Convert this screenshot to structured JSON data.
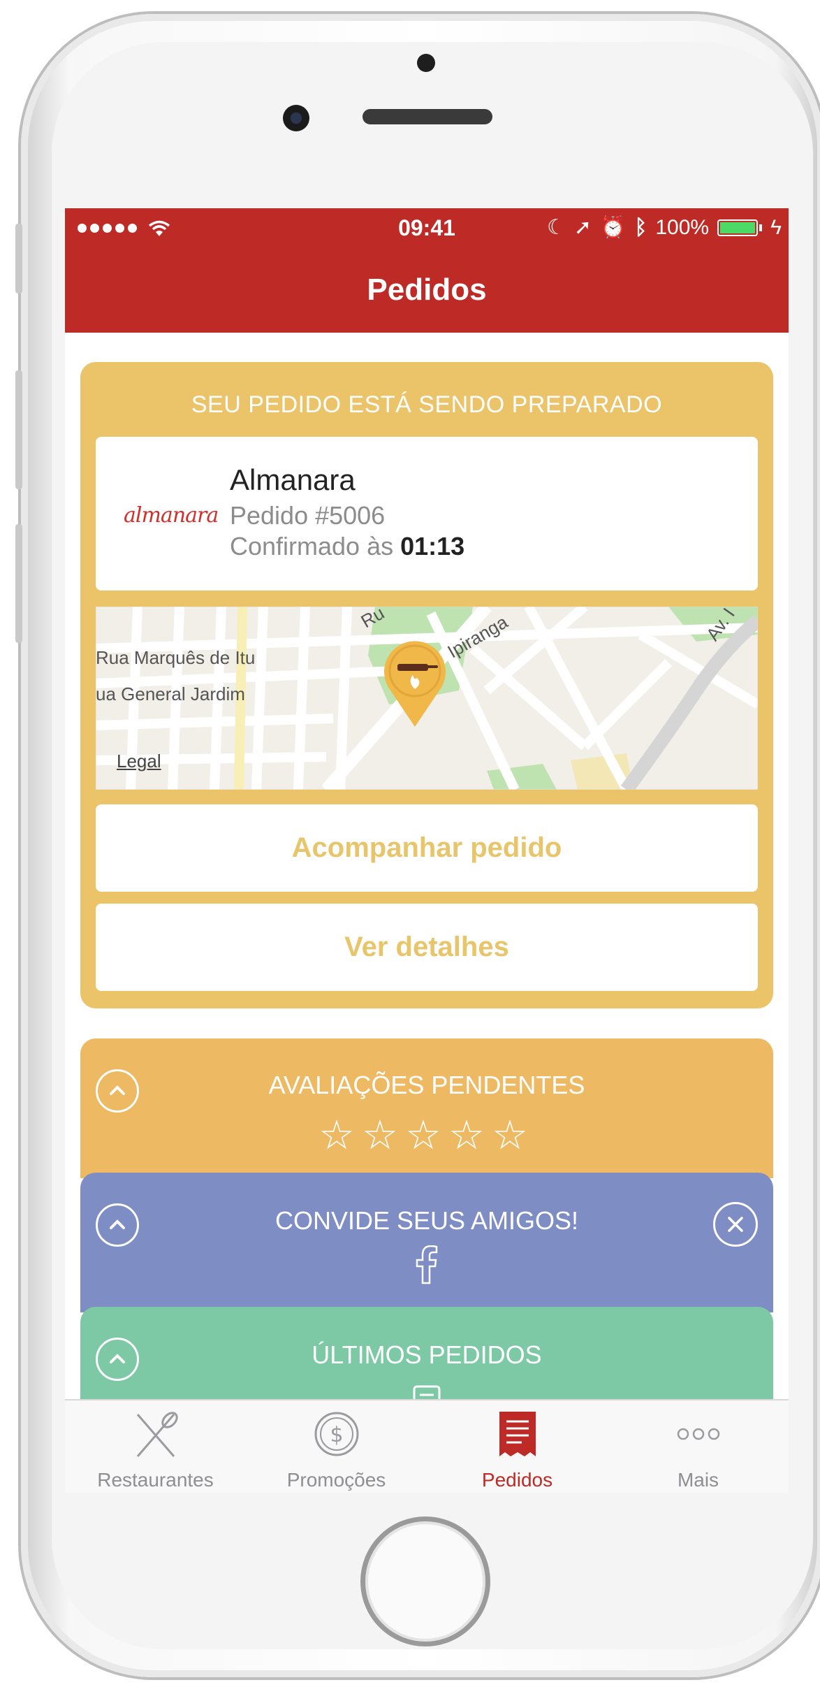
{
  "status_bar": {
    "time": "09:41",
    "battery": "100%"
  },
  "nav": {
    "title": "Pedidos"
  },
  "order_card": {
    "header": "SEU PEDIDO ESTÁ SENDO PREPARADO",
    "restaurant": {
      "logo_text": "almanara",
      "name": "Almanara",
      "order_number": "Pedido #5006",
      "confirmed_label": "Confirmado às",
      "confirmed_time": "01:13"
    },
    "map": {
      "labels": [
        "Rua Marquês de Itu",
        "ua General Jardim",
        "Ipiranga",
        "Ru",
        "Av. I"
      ],
      "legal": "Legal"
    },
    "track_button": "Acompanhar pedido",
    "details_button": "Ver detalhes"
  },
  "panels": {
    "reviews": {
      "title": "AVALIAÇÕES PENDENTES",
      "stars": "☆☆☆☆☆",
      "color": "#edb962"
    },
    "invite": {
      "title": "CONVIDE SEUS AMIGOS!",
      "icon": "facebook-icon",
      "color": "#7f8dc5"
    },
    "last_orders": {
      "title": "ÚLTIMOS PEDIDOS",
      "color": "#7dc9a6"
    }
  },
  "tabbar": {
    "items": [
      {
        "label": "Restaurantes",
        "icon": "fork-knife-icon"
      },
      {
        "label": "Promoções",
        "icon": "dollar-coin-icon"
      },
      {
        "label": "Pedidos",
        "icon": "receipt-icon",
        "active": true
      },
      {
        "label": "Mais",
        "icon": "more-dots-icon"
      }
    ]
  },
  "colors": {
    "brand_red": "#be2a26",
    "order_yellow": "#ebc46a",
    "button_text": "#e8c56a"
  }
}
